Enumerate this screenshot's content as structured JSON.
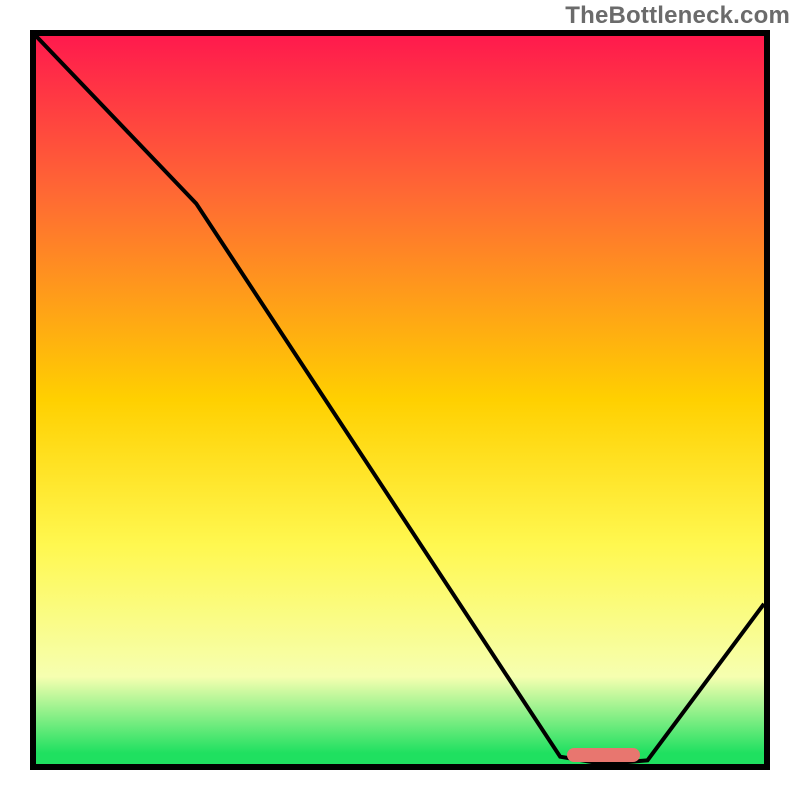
{
  "watermark": "TheBottleneck.com",
  "colors": {
    "frame": "#000000",
    "curve": "#000000",
    "gradient_top": "#ff1a4d",
    "gradient_mid1": "#ff6a33",
    "gradient_mid2": "#ffd000",
    "gradient_mid3": "#fff850",
    "gradient_low": "#f6ffb0",
    "gradient_bottom": "#1fe060",
    "marker": "#e8766f"
  },
  "chart_data": {
    "type": "line",
    "title": "",
    "xlabel": "",
    "ylabel": "",
    "xlim": [
      0,
      100
    ],
    "ylim": [
      0,
      100
    ],
    "gradient_stops": [
      {
        "offset": 0,
        "color": "#ff1a4d"
      },
      {
        "offset": 22,
        "color": "#ff6a33"
      },
      {
        "offset": 50,
        "color": "#ffd000"
      },
      {
        "offset": 70,
        "color": "#fff850"
      },
      {
        "offset": 88,
        "color": "#f6ffb0"
      },
      {
        "offset": 98.5,
        "color": "#1fe060"
      },
      {
        "offset": 100,
        "color": "#1fe060"
      }
    ],
    "series": [
      {
        "name": "curve",
        "points": [
          {
            "x": 0,
            "y": 100
          },
          {
            "x": 22,
            "y": 77
          },
          {
            "x": 72,
            "y": 1
          },
          {
            "x": 78,
            "y": 0
          },
          {
            "x": 84,
            "y": 0.5
          },
          {
            "x": 100,
            "y": 22
          }
        ]
      }
    ],
    "marker": {
      "x_center": 78,
      "width": 10,
      "y": 0
    }
  }
}
